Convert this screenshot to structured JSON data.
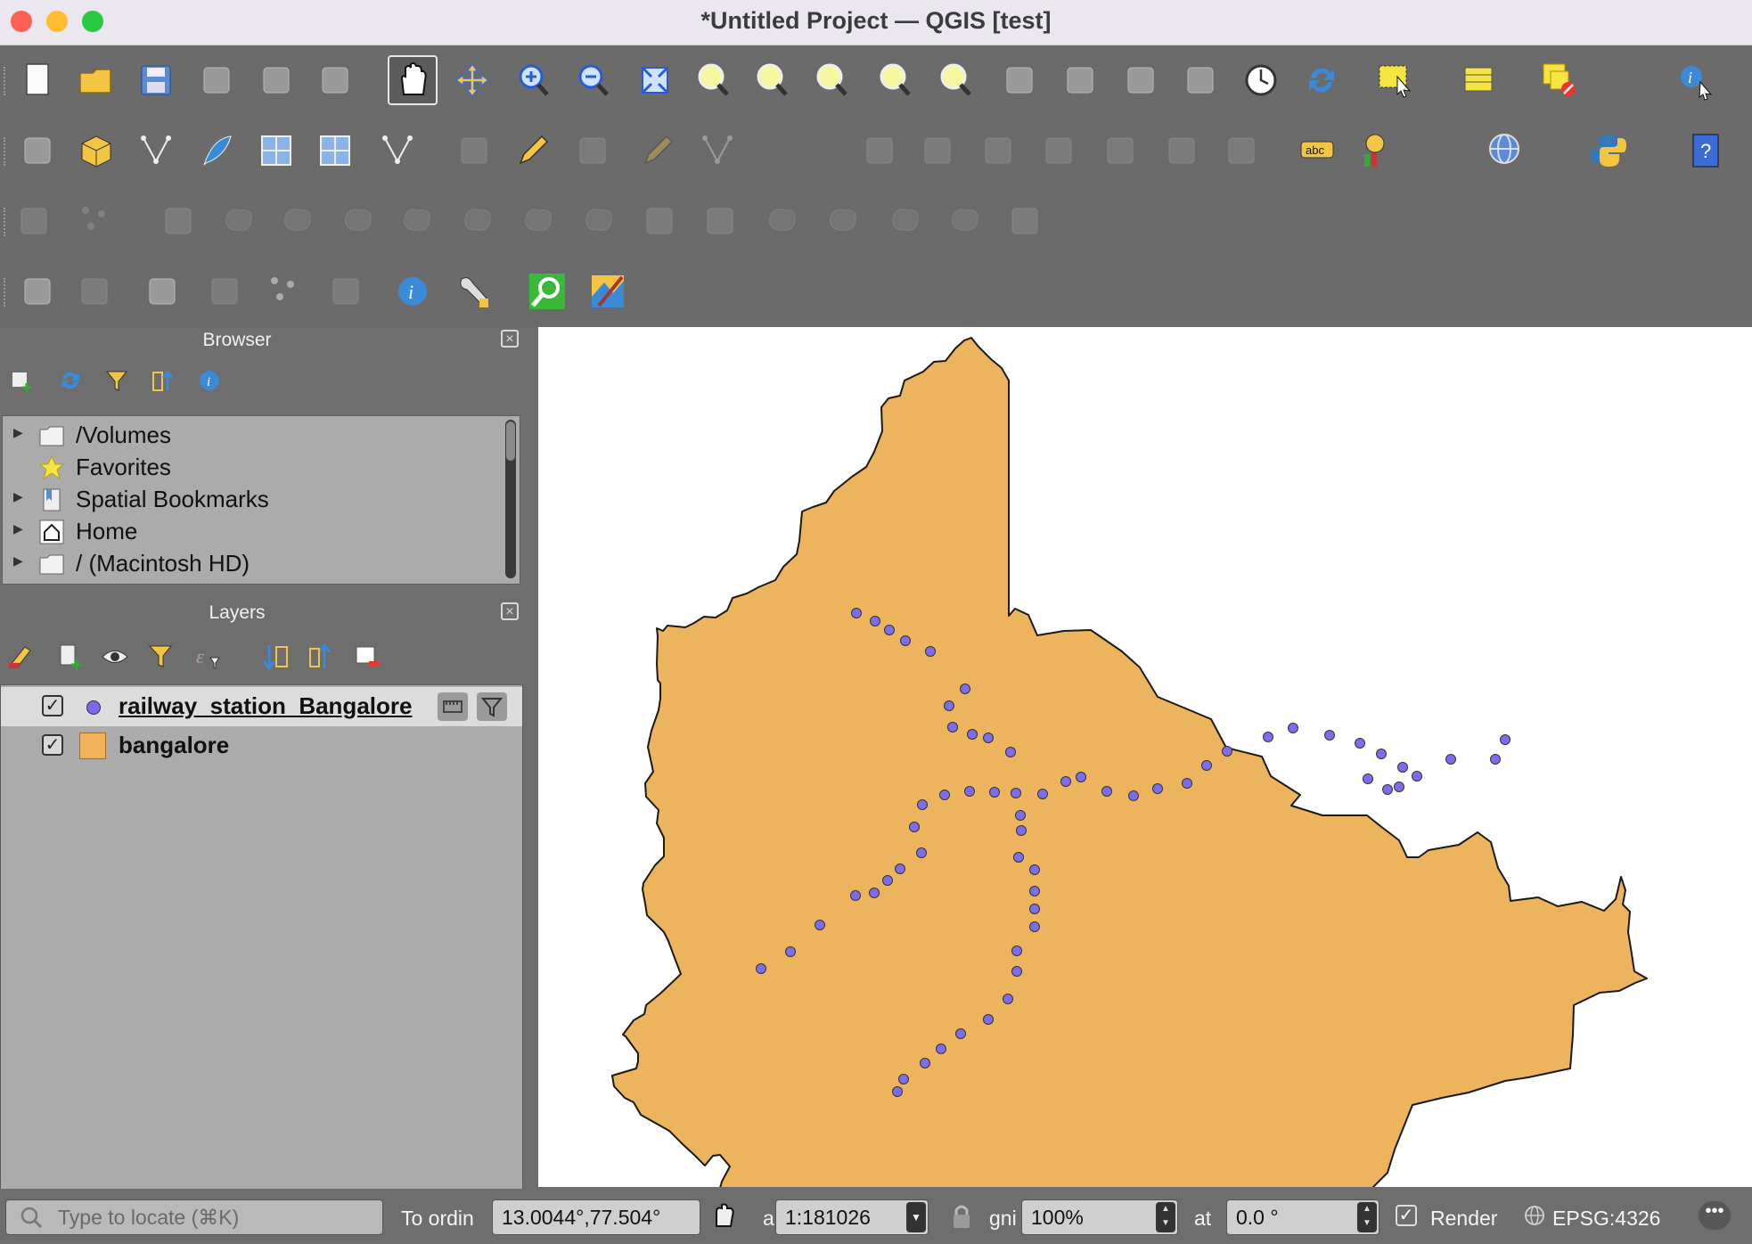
{
  "window": {
    "title": "*Untitled Project — QGIS [test]",
    "traffic_lights": {
      "close": "#fe5f57",
      "minimize": "#febc2e",
      "zoom": "#28c840"
    }
  },
  "toolbars": {
    "row1": [
      "new-project-icon",
      "open-project-icon",
      "save-project-icon",
      "new-print-layout-icon",
      "style-manager-icon",
      "layer-styling-icon",
      "pan-map-icon",
      "pan-to-selection-icon",
      "zoom-in-icon",
      "zoom-out-icon",
      "zoom-full-icon",
      "zoom-to-selection-icon",
      "zoom-to-layer-icon",
      "zoom-native-icon",
      "zoom-last-icon",
      "zoom-next-icon",
      "new-map-view-icon",
      "new-3d-map-view-icon",
      "new-bookmark-icon",
      "show-bookmarks-icon",
      "temporal-controller-icon",
      "refresh-icon",
      "select-features-icon",
      "open-attribute-table-icon",
      "deselect-all-icon",
      "identify-features-icon"
    ],
    "row2": [
      "data-source-manager-icon",
      "new-geopackage-layer-icon",
      "new-shapefile-layer-icon",
      "new-spatialite-layer-icon",
      "new-virtual-layer-icon",
      "new-mesh-layer-icon",
      "new-temporary-scratch-layer-icon",
      "current-edits-icon",
      "toggle-editing-icon",
      "save-edits-icon",
      "digitize-icon",
      "vertex-tool-icon",
      "modify-attributes-icon",
      "delete-selected-icon",
      "cut-features-icon",
      "copy-features-icon",
      "paste-features-icon",
      "undo-icon",
      "redo-icon",
      "label-tool-icon",
      "diagram-icon",
      "metasearch-icon",
      "python-console-icon",
      "help-icon"
    ],
    "row3": [
      "measure-icon",
      "move-feature-icon",
      "rotate-feature-icon",
      "simplify-icon",
      "add-ring-icon",
      "add-part-icon",
      "fill-ring-icon",
      "delete-ring-icon",
      "delete-part-icon",
      "reshape-icon",
      "offset-curve-icon",
      "reverse-line-icon",
      "split-features-icon",
      "split-parts-icon",
      "merge-features-icon",
      "merge-attributes-icon",
      "rotate-point-symbols-icon"
    ],
    "row4": [
      "map-tips-icon",
      "snapping-icon",
      "gps-icon",
      "georeferencer-icon",
      "point-cluster-icon",
      "node-tool-icon",
      "info-icon",
      "plugin-tool-icon",
      "locator-search-icon",
      "map-decoration-icon"
    ]
  },
  "browser": {
    "title": "Browser",
    "tools": [
      "add-selected-layers-icon",
      "refresh-icon",
      "filter-icon",
      "collapse-all-icon",
      "properties-icon"
    ],
    "items": [
      {
        "label": "/Volumes",
        "icon": "folder-icon",
        "expandable": true
      },
      {
        "label": "Favorites",
        "icon": "star-icon",
        "expandable": false
      },
      {
        "label": "Spatial Bookmarks",
        "icon": "bookmark-icon",
        "expandable": true
      },
      {
        "label": "Home",
        "icon": "home-icon",
        "expandable": true
      },
      {
        "label": "/ (Macintosh HD)",
        "icon": "folder-icon",
        "expandable": true
      }
    ]
  },
  "layers": {
    "title": "Layers",
    "tools": [
      "style-icon",
      "add-group-icon",
      "visibility-icon",
      "filter-legend-icon",
      "expression-filter-icon",
      "expand-all-icon",
      "collapse-all-icon",
      "remove-layer-icon"
    ],
    "items": [
      {
        "name": "railway_station_Bangalore",
        "checked": true,
        "symbol": "point",
        "color": "#7b68ee",
        "selected": true
      },
      {
        "name": "bangalore",
        "checked": true,
        "symbol": "polygon",
        "color": "#f0b35a",
        "selected": false
      }
    ]
  },
  "map": {
    "polygon_fill": "#ecb45d",
    "polygon_stroke": "#1a1a1a",
    "point_fill": "#7d6cf0"
  },
  "status": {
    "search_placeholder": "Type to locate (⌘K)",
    "coordinate_label_fragment": "To   ordin",
    "coordinate": "13.0044°,77.504°",
    "scale_label_fragment": "a",
    "scale": "1:181026",
    "magnifier_label_fragment": "gni",
    "magnifier": "100%",
    "rotation_label_fragment": "at",
    "rotation": "0.0 °",
    "render_label": "Render",
    "render_checked": true,
    "crs": "EPSG:4326"
  }
}
